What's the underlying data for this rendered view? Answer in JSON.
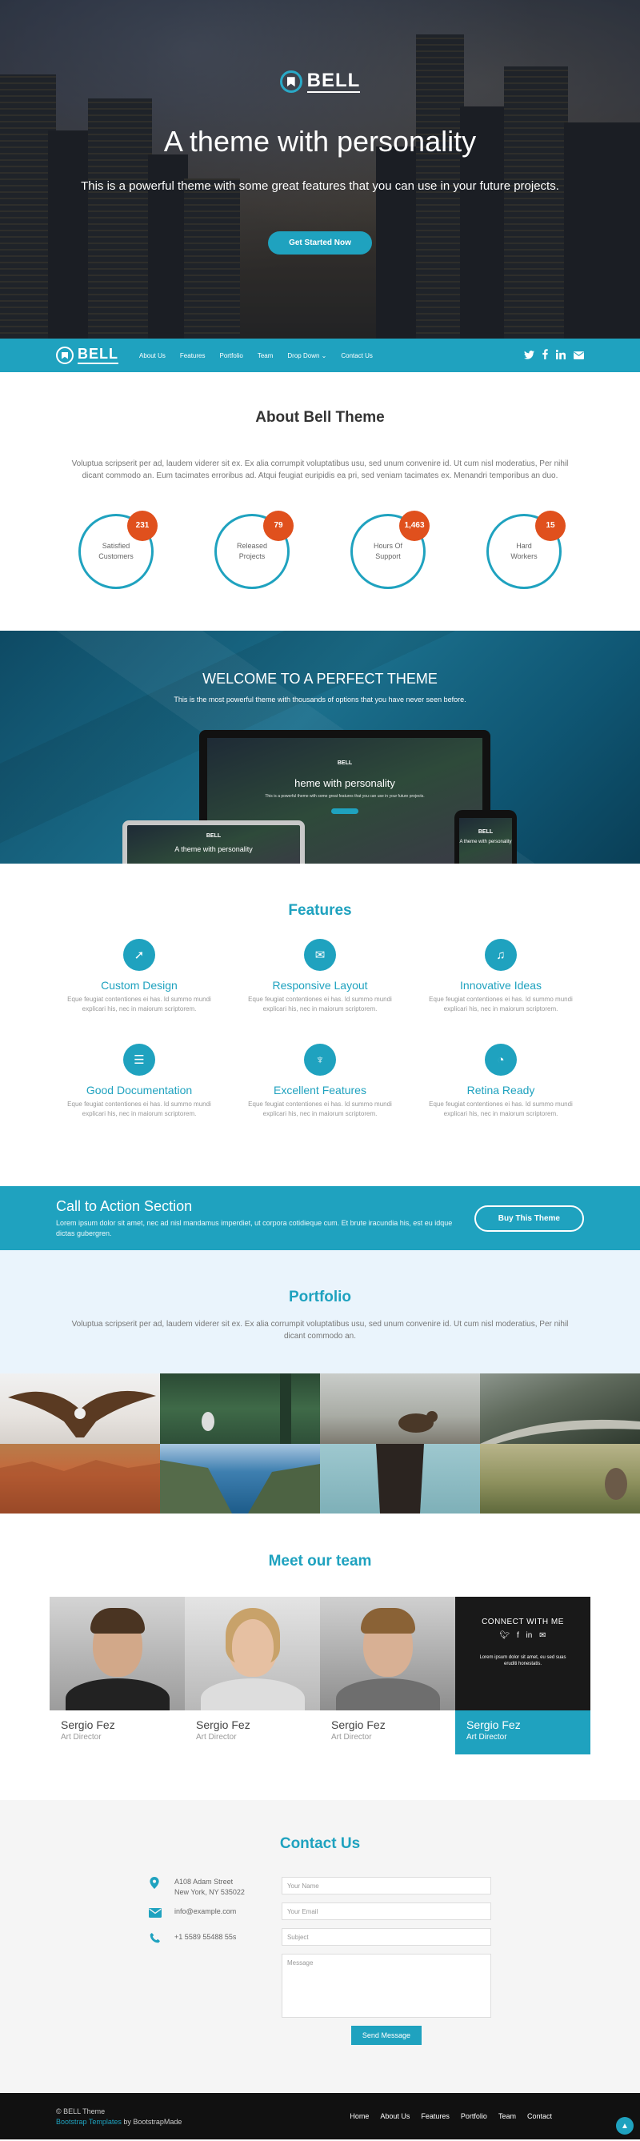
{
  "hero": {
    "brand": "BELL",
    "title": "A theme with personality",
    "subtitle": "This is a powerful theme with some great features that you can use in your future projects.",
    "cta": "Get Started Now"
  },
  "nav": {
    "brand": "BELL",
    "items": [
      "About Us",
      "Features",
      "Portfolio",
      "Team",
      "Drop Down ⌄",
      "Contact Us"
    ],
    "social": [
      "twitter-icon",
      "facebook-icon",
      "linkedin-icon",
      "envelope-icon"
    ]
  },
  "about": {
    "title": "About Bell Theme",
    "desc": "Voluptua scripserit per ad, laudem viderer sit ex. Ex alia corrumpit voluptatibus usu, sed unum convenire id. Ut cum nisl moderatius, Per nihil dicant commodo an. Eum tacimates erroribus ad. Atqui feugiat euripidis ea pri, sed veniam tacimates ex. Menandri temporibus an duo.",
    "counters": [
      {
        "count": "231",
        "label1": "Satisfied",
        "label2": "Customers"
      },
      {
        "count": "79",
        "label1": "Released",
        "label2": "Projects"
      },
      {
        "count": "1,463",
        "label1": "Hours Of",
        "label2": "Support"
      },
      {
        "count": "15",
        "label1": "Hard",
        "label2": "Workers"
      }
    ]
  },
  "welcome": {
    "title": "WELCOME TO A PERFECT THEME",
    "subtitle": "This is the most powerful theme with thousands of options that you have never seen before.",
    "mockup_brand": "BELL",
    "mockup_title": "A theme with personality",
    "mockup_title_monitor": "heme with personality",
    "mockup_sub": "This is a powerful theme with some great features that you can use in your future projects.",
    "mockup_title_phone": "A theme with personality"
  },
  "features": {
    "title": "Features",
    "items": [
      {
        "icon": "rocket-icon",
        "glyph": "➚",
        "title": "Custom Design",
        "text": "Eque feugiat contentiones ei has. Id summo mundi explicari his, nec in maiorum scriptorem."
      },
      {
        "icon": "envelope-icon",
        "glyph": "✉",
        "title": "Responsive Layout",
        "text": "Eque feugiat contentiones ei has. Id summo mundi explicari his, nec in maiorum scriptorem."
      },
      {
        "icon": "bell-icon",
        "glyph": "♫",
        "title": "Innovative Ideas",
        "text": "Eque feugiat contentiones ei has. Id summo mundi explicari his, nec in maiorum scriptorem."
      },
      {
        "icon": "database-icon",
        "glyph": "☰",
        "title": "Good Documentation",
        "text": "Eque feugiat contentiones ei has. Id summo mundi explicari his, nec in maiorum scriptorem."
      },
      {
        "icon": "cutlery-icon",
        "glyph": "♆",
        "title": "Excellent Features",
        "text": "Eque feugiat contentiones ei has. Id summo mundi explicari his, nec in maiorum scriptorem."
      },
      {
        "icon": "dashboard-icon",
        "glyph": "◔",
        "title": "Retina Ready",
        "text": "Eque feugiat contentiones ei has. Id summo mundi explicari his, nec in maiorum scriptorem."
      }
    ]
  },
  "cta": {
    "title": "Call to Action Section",
    "text": "Lorem ipsum dolor sit amet, nec ad nisl mandamus imperdiet, ut corpora cotidieque cum. Et brute iracundia his, est eu idque dictas gubergren.",
    "button": "Buy This Theme"
  },
  "portfolio": {
    "title": "Portfolio",
    "desc": "Voluptua scripserit per ad, laudem viderer sit ex. Ex alia corrumpit voluptatibus usu, sed unum convenire id. Ut cum nisl moderatius, Per nihil dicant commodo an."
  },
  "team": {
    "title": "Meet our team",
    "members": [
      {
        "name": "Sergio Fez",
        "role": "Art Director"
      },
      {
        "name": "Sergio Fez",
        "role": "Art Director"
      },
      {
        "name": "Sergio Fez",
        "role": "Art Director"
      },
      {
        "name": "Sergio Fez",
        "role": "Art Director"
      }
    ],
    "connect": {
      "title": "CONNECT WITH ME",
      "text": "Lorem ipsum dolor sit amet, eu sed suas eruditi honestatis."
    }
  },
  "contact": {
    "title": "Contact Us",
    "address1": "A108 Adam Street",
    "address2": "New York, NY 535022",
    "email": "info@example.com",
    "phone": "+1 5589 55488 55s",
    "placeholders": {
      "name": "Your Name",
      "email": "Your Email",
      "subject": "Subject",
      "message": "Message"
    },
    "send": "Send Message"
  },
  "footer": {
    "copyright": "© BELL Theme",
    "credit_link": "Bootstrap Templates",
    "credit_by": " by BootstrapMade",
    "links": [
      "Home",
      "About Us",
      "Features",
      "Portfolio",
      "Team",
      "Contact"
    ]
  },
  "colors": {
    "accent": "#1fa2bf",
    "badge": "#e0501d",
    "footer": "#111111"
  }
}
